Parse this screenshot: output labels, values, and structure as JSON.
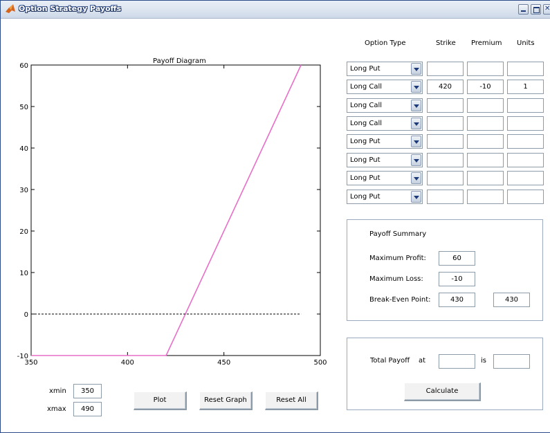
{
  "window": {
    "title": "Option Strategy Payoffs"
  },
  "plot": {
    "title": "Payoff Diagram",
    "x_ticks": [
      "350",
      "400",
      "450",
      "500"
    ],
    "y_ticks": [
      "60",
      "50",
      "40",
      "30",
      "20",
      "10",
      "0",
      "-10"
    ],
    "line_color": "#e86ec8"
  },
  "chart_data": {
    "type": "line",
    "title": "Payoff Diagram",
    "xlabel": "",
    "ylabel": "",
    "xlim": [
      350,
      500
    ],
    "ylim": [
      -10,
      60
    ],
    "grid": false,
    "series": [
      {
        "x": [
          350,
          420,
          490
        ],
        "y": [
          -10,
          -10,
          60
        ],
        "color": "#e86ec8",
        "style": "solid"
      },
      {
        "x": [
          350,
          490
        ],
        "y": [
          0,
          0
        ],
        "color": "#000000",
        "style": "dashed"
      }
    ]
  },
  "range": {
    "xmin_label": "xmin",
    "xmin_value": "350",
    "xmax_label": "xmax",
    "xmax_value": "490"
  },
  "buttons": {
    "plot": "Plot",
    "reset_graph": "Reset Graph",
    "reset_all": "Reset All",
    "calculate": "Calculate"
  },
  "table": {
    "headers": {
      "type": "Option Type",
      "strike": "Strike",
      "premium": "Premium",
      "units": "Units"
    },
    "rows": [
      {
        "type": "Long Put",
        "strike": "",
        "premium": "",
        "units": ""
      },
      {
        "type": "Long Call",
        "strike": "420",
        "premium": "-10",
        "units": "1"
      },
      {
        "type": "Long Call",
        "strike": "",
        "premium": "",
        "units": ""
      },
      {
        "type": "Long Call",
        "strike": "",
        "premium": "",
        "units": ""
      },
      {
        "type": "Long Put",
        "strike": "",
        "premium": "",
        "units": ""
      },
      {
        "type": "Long Put",
        "strike": "",
        "premium": "",
        "units": ""
      },
      {
        "type": "Long Put",
        "strike": "",
        "premium": "",
        "units": ""
      },
      {
        "type": "Long Put",
        "strike": "",
        "premium": "",
        "units": ""
      }
    ]
  },
  "summary": {
    "title": "Payoff Summary",
    "max_profit_label": "Maximum Profit:",
    "max_profit": "60",
    "max_loss_label": "Maximum Loss:",
    "max_loss": "-10",
    "breakeven_label": "Break-Even Point:",
    "breakeven_1": "430",
    "breakeven_2": "430"
  },
  "total": {
    "label": "Total Payoff",
    "at_label": "at",
    "is_label": "is",
    "at_value": "",
    "is_value": ""
  }
}
